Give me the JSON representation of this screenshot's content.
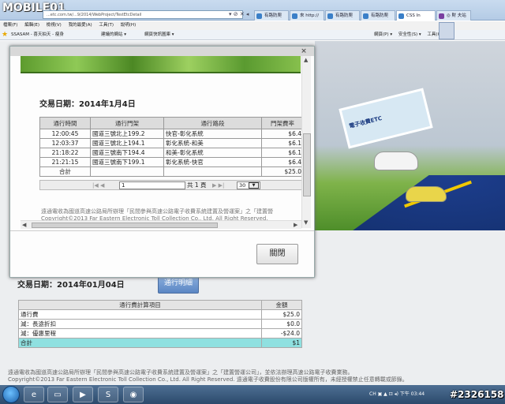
{
  "browser": {
    "logo": "MOBILE01",
    "address": "...etc.com.tw/...9/2014/WebProject/TestEtcDetail",
    "tabs": [
      "有路防爬",
      "來 http://",
      "有路防爬",
      "有路防爬",
      "CSS In",
      "◎ 財 夫站"
    ],
    "menu": [
      "檔案(F)",
      "編輯(E)",
      "檢視(V)",
      "我的最愛(A)",
      "工具(T)",
      "說明(H)"
    ],
    "favorites": [
      "SSASAM - 喜天拍天 - 瘦身",
      "建議的網站 ▾",
      "網頁快訊圖庫 ▾"
    ],
    "commands": [
      "網頁(P) ▾",
      "安全性(S) ▾",
      "工具(O) ▾"
    ]
  },
  "modal": {
    "date_label": "交易日期：2014年1月4日",
    "close_symbol": "×",
    "headers": [
      "通行時間",
      "通行門架",
      "通行路段",
      "門架費率"
    ],
    "rows": [
      [
        "12:00:45",
        "國道三號北上199.2",
        "快官-彰化系統",
        "$6.4"
      ],
      [
        "12:03:37",
        "國道三號北上194.1",
        "彰化系統-和美",
        "$6.1"
      ],
      [
        "21:18:22",
        "國道三號南下194.4",
        "和美-彰化系統",
        "$6.1"
      ],
      [
        "21:21:15",
        "國道三號南下199.1",
        "彰化系統-快官",
        "$6.4"
      ]
    ],
    "total_label": "合計",
    "total_value": "$25.0",
    "pager": {
      "first_prev": "|◀ ◀",
      "page_value": "1",
      "of_label": "共 1 頁",
      "next_last": "▶ ▶|",
      "rows_value": "30",
      "drop": "▼"
    },
    "footer_line1": "遠通電收為國道高速公路局所辦理「民間參與高速公路電子收費系統建置及營運案」之「建置營",
    "footer_line2": "Copyright©2013 Far Eastern Electronic Toll Collection Co., Ltd. All Right Reserved.",
    "close_button": "關閉"
  },
  "page": {
    "banner_label": "電子收費ETC",
    "date_label": "交易日期：2014年01月04日",
    "detail_button": "通行明細",
    "calc_headers": [
      "通行費計算項目",
      "金額"
    ],
    "calc_rows": [
      [
        "通行費",
        "$25.0"
      ],
      [
        "減：長途折扣",
        "$0.0"
      ],
      [
        "減：優惠里程",
        "-$24.0"
      ],
      [
        "合計",
        "$1"
      ]
    ],
    "footer_line1": "遠通電收為國道高速公路局所辦理「民間參與高速公路電子收費系統建置及營運案」之「建置營運公司」，並依法辦理高速公路電子收費業務。",
    "footer_line2": "Copyright©2013 Far Eastern Electronic Toll Collection Co., Ltd. All Right Reserved. 遠通電子收費股份有限公司版權所有，未經授權禁止任意轉載或節錄。"
  },
  "taskbar": {
    "tray": "CH ▣ ▲ ⊡ ◂) 下午 03:44",
    "watermark": "#2326158"
  },
  "colors": {
    "accent": "#5b86c4",
    "sum_row": "#8fe0e0",
    "taskbar": "#2c4a6c"
  }
}
